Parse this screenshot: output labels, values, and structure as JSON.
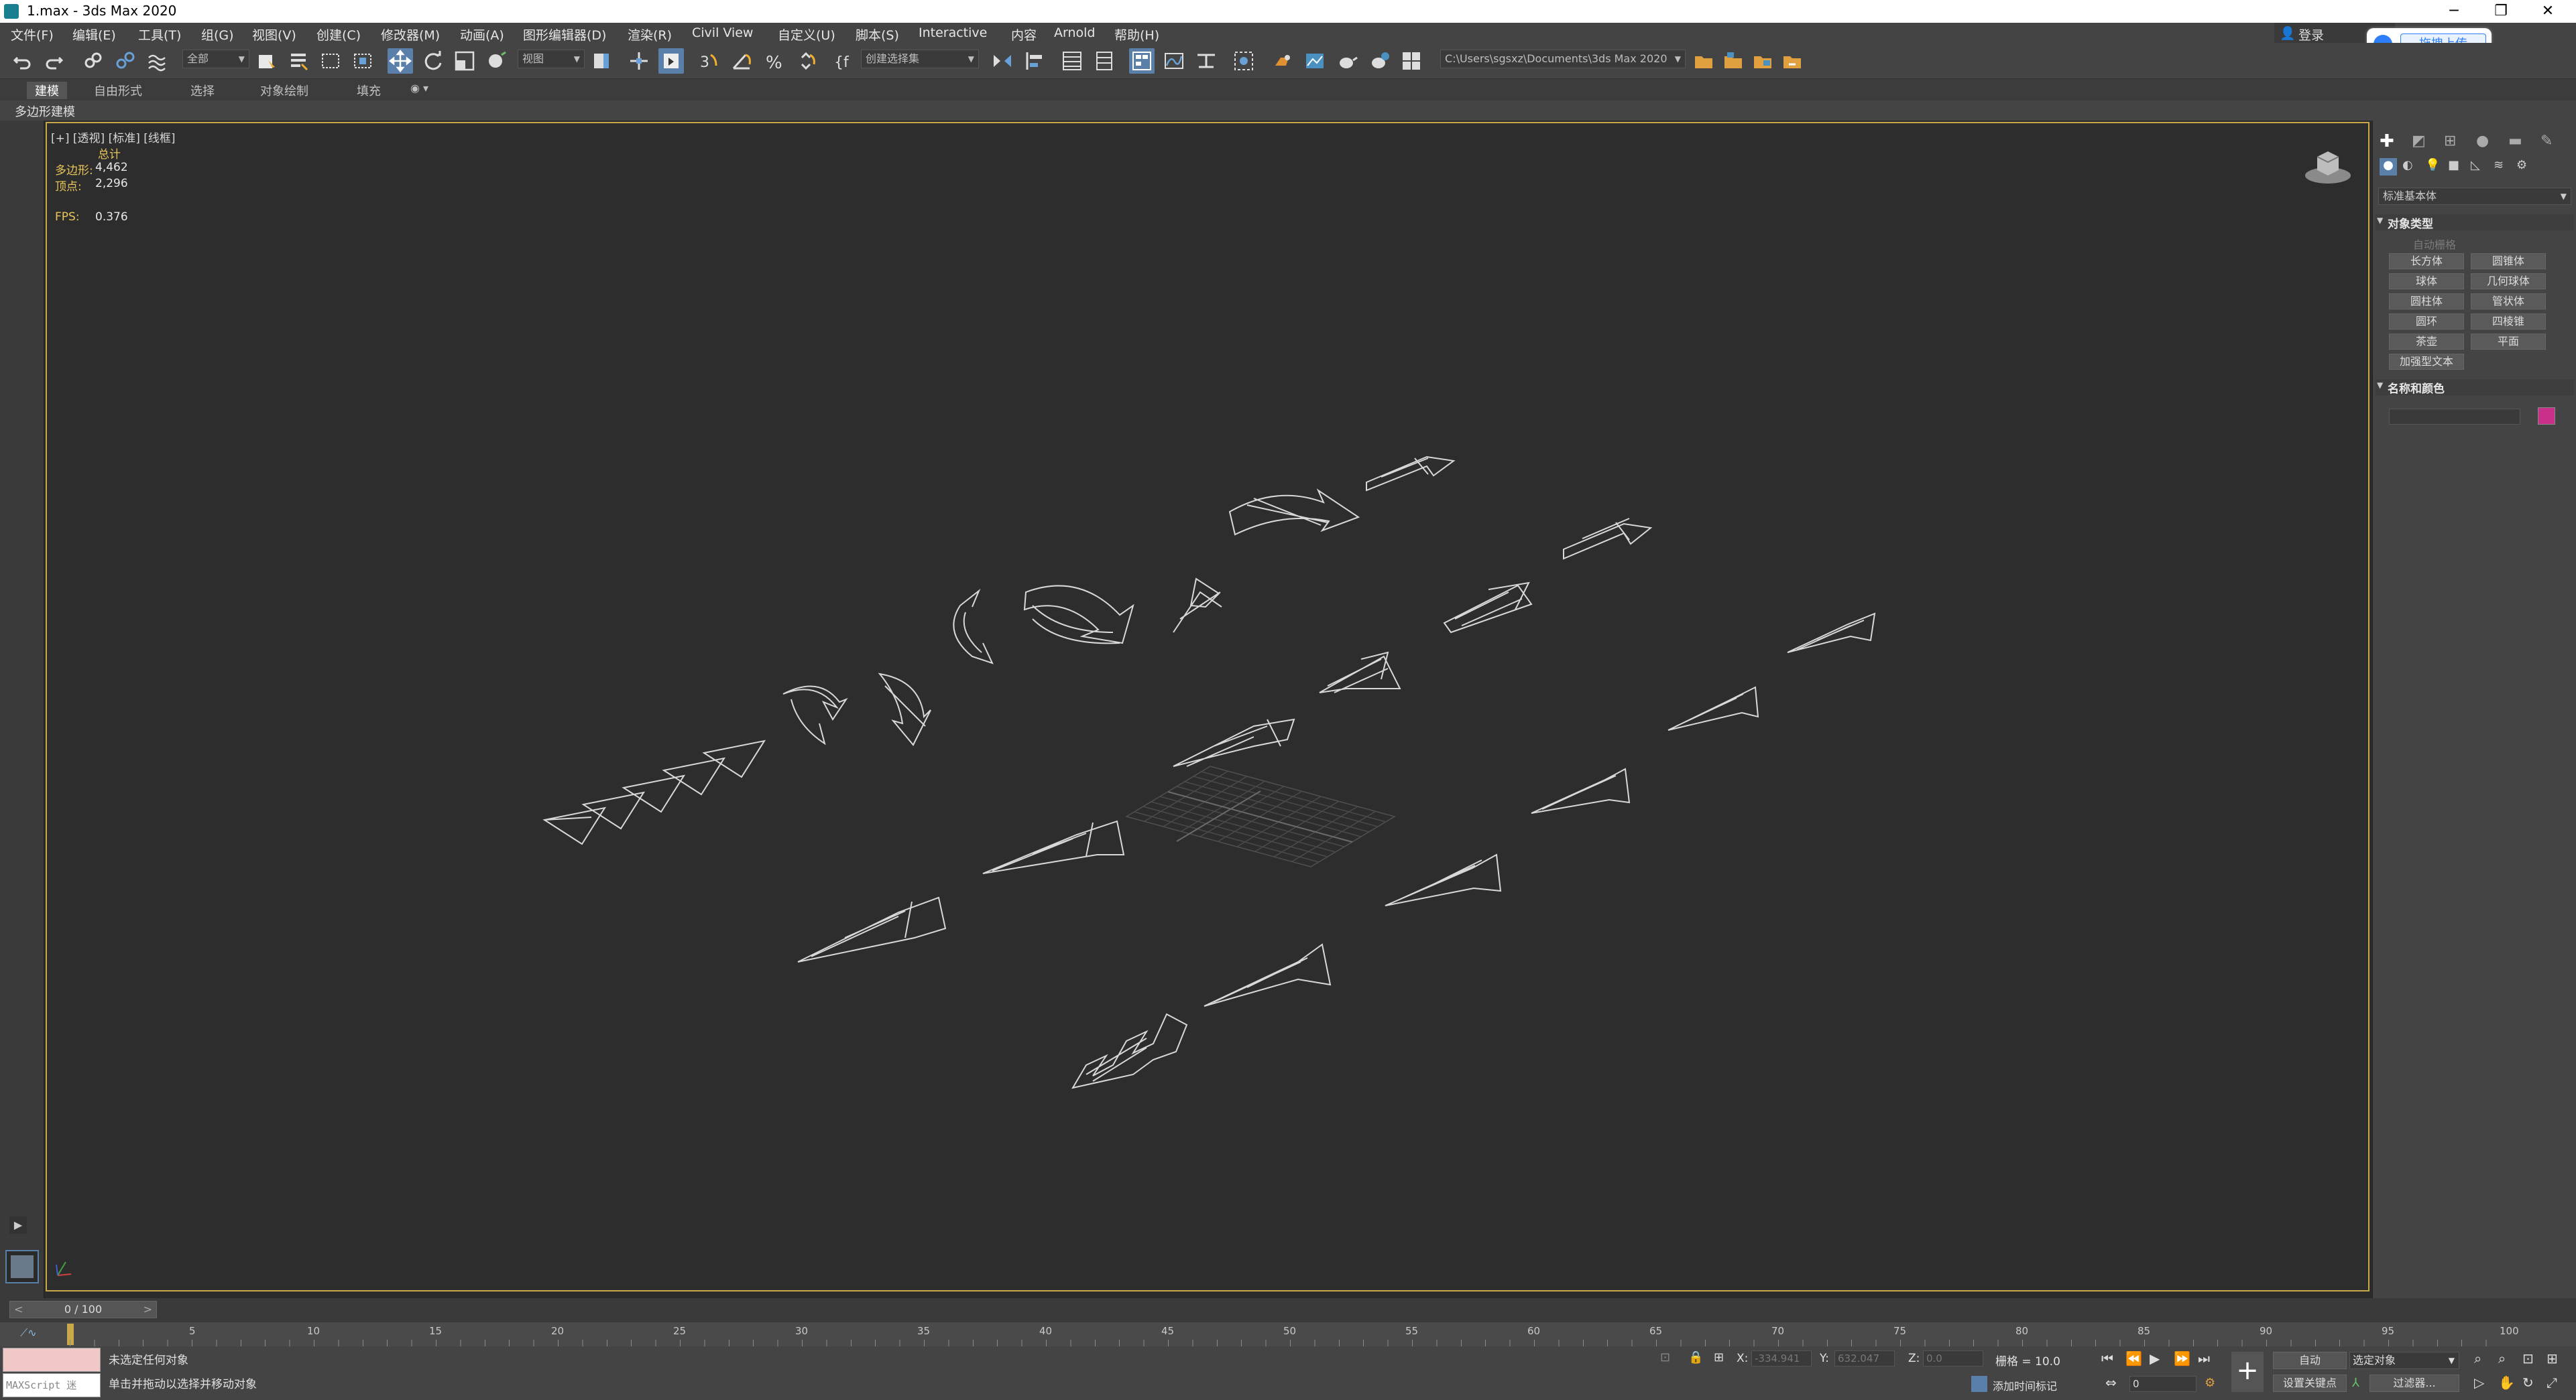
{
  "window": {
    "title": "1.max - 3ds Max 2020"
  },
  "window_controls": {
    "minimize": "─",
    "restore": "❐",
    "close": "✕"
  },
  "menu": [
    "文件(F)",
    "编辑(E)",
    "工具(T)",
    "组(G)",
    "视图(V)",
    "创建(C)",
    "修改器(M)",
    "动画(A)",
    "图形编辑器(D)",
    "渲染(R)",
    "Civil View",
    "自定义(U)",
    "脚本(S)",
    "Interactive",
    "内容",
    "Arnold",
    "帮助(H)"
  ],
  "login": {
    "label": "登录"
  },
  "upload": {
    "label": "拖拽上传"
  },
  "toolbar": {
    "filter": "全部",
    "ref_coord": "视图",
    "selection_set": "创建选择集",
    "project_path": "C:\\Users\\sgsxz\\Documents\\3ds Max 2020"
  },
  "ribbon": {
    "tabs": [
      "建模",
      "自由形式",
      "选择",
      "对象绘制",
      "填充"
    ],
    "panel_label": "多边形建模"
  },
  "viewport": {
    "label": "[+] [透视] [标准] [线框]",
    "stats_header": "总计",
    "polys_label": "多边形:",
    "polys_value": "4,462",
    "verts_label": "顶点:",
    "verts_value": "2,296",
    "fps_label": "FPS:",
    "fps_value": "0.376"
  },
  "command_panel": {
    "category": "标准基本体",
    "object_type_header": "对象类型",
    "autogrid": "自动栅格",
    "buttons": [
      "长方体",
      "圆锥体",
      "球体",
      "几何球体",
      "圆柱体",
      "管状体",
      "圆环",
      "四棱锥",
      "茶壶",
      "平面",
      "加强型文本"
    ],
    "name_color_header": "名称和颜色",
    "object_color": "#c8308a"
  },
  "timeline": {
    "frame_display": "0 / 100",
    "ticks": [
      "5",
      "10",
      "15",
      "20",
      "25",
      "30",
      "35",
      "40",
      "45",
      "50",
      "55",
      "60",
      "65",
      "70",
      "75",
      "80",
      "85",
      "90",
      "95",
      "100"
    ]
  },
  "status": {
    "maxscript": "MAXScript 迷",
    "line1": "未选定任何对象",
    "line2": "单击并拖动以选择并移动对象",
    "x_label": "X:",
    "x_value": "-334.941",
    "y_label": "Y:",
    "y_value": "632.047",
    "z_label": "Z:",
    "z_value": "0.0",
    "grid": "栅格 = 10.0",
    "add_time_tag": "添加时间标记",
    "auto_key": "自动",
    "selected_object": "选定对象",
    "set_key": "设置关键点",
    "filters": "过滤器...",
    "current_frame": "0"
  },
  "colors": {
    "viewport_border": "#c9a84a",
    "accent_blue": "#5a7fa8",
    "object_color": "#c8308a"
  }
}
